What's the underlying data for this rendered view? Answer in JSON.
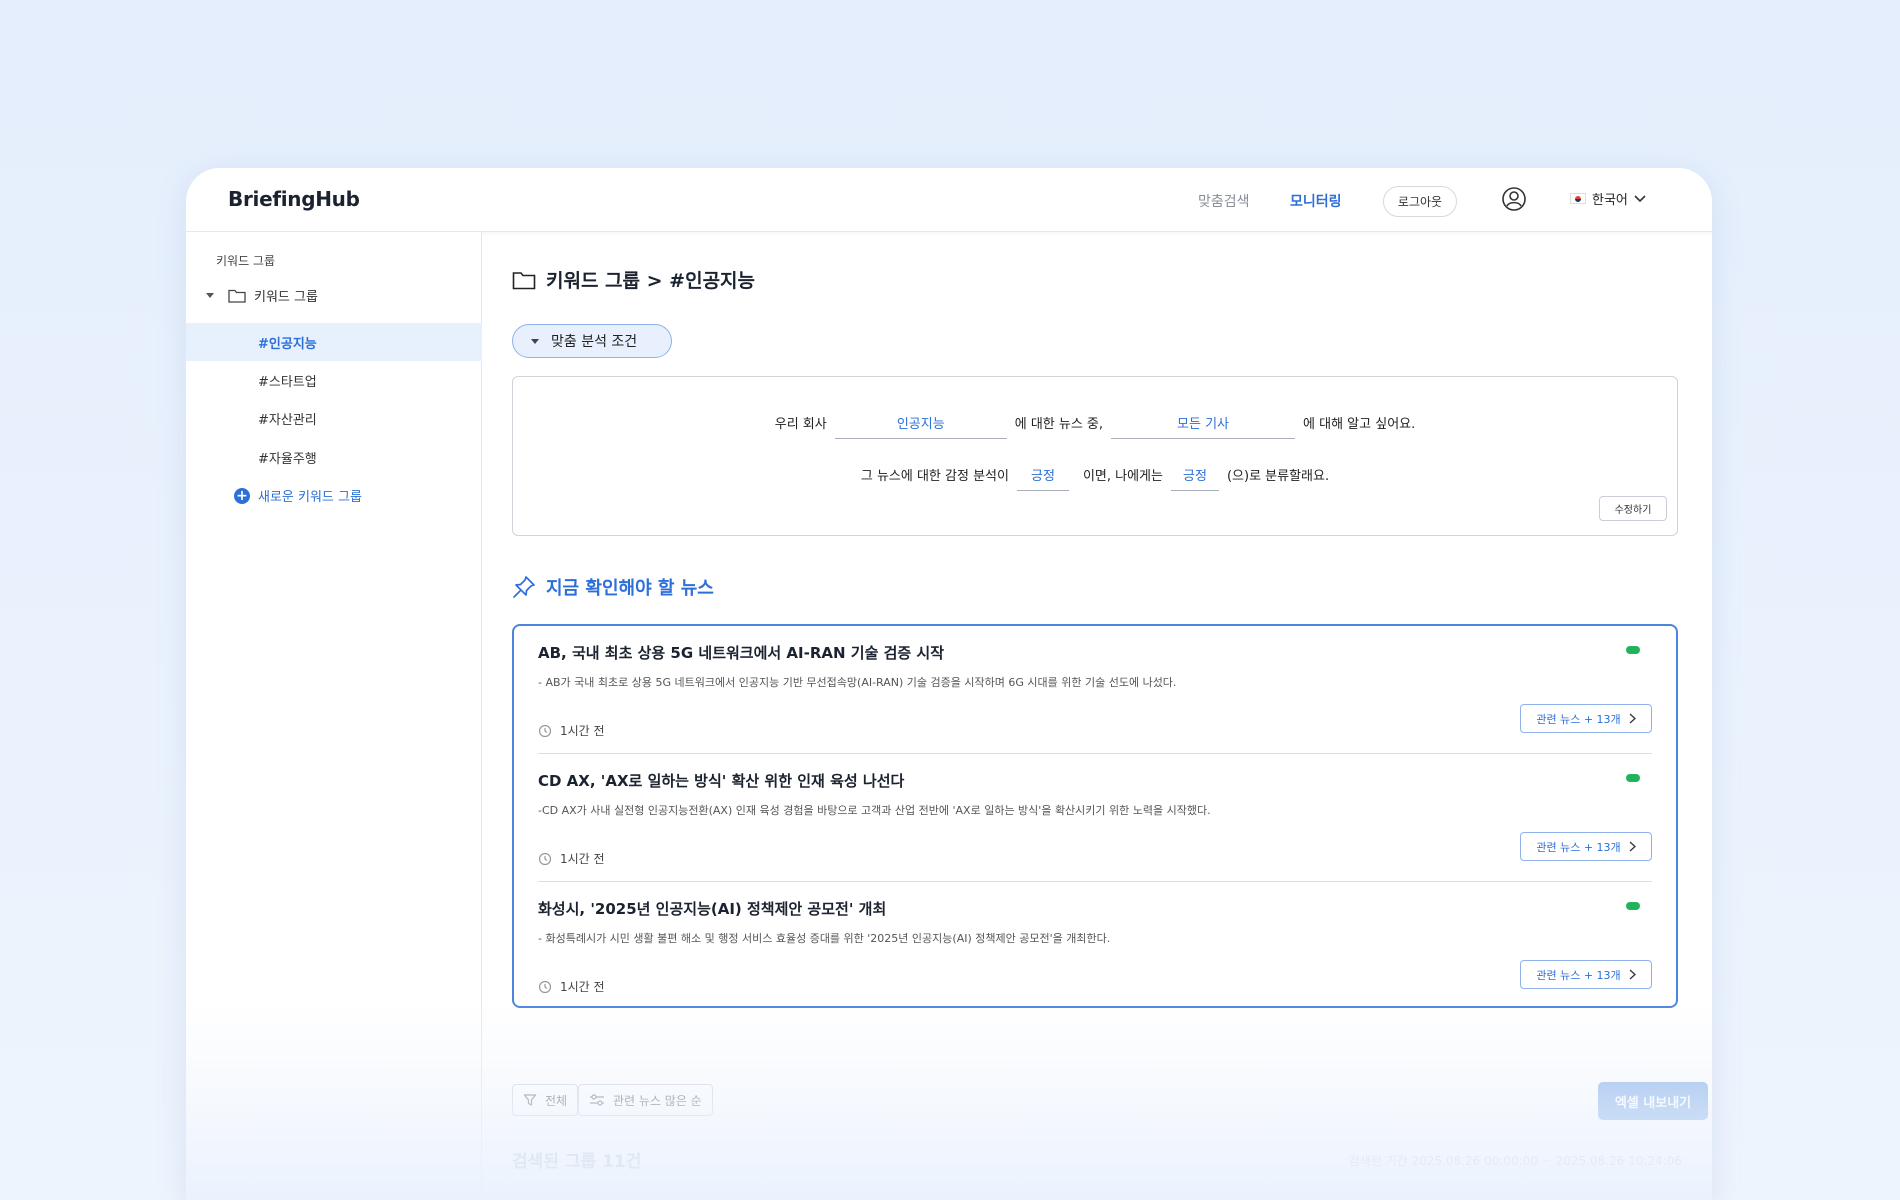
{
  "header": {
    "logo": "BriefingHub",
    "nav": [
      "맞춤검색",
      "모니터링"
    ],
    "active_nav": "모니터링",
    "logout_label": "로그아웃",
    "language": "한국어"
  },
  "sidebar": {
    "heading": "키워드 그룹",
    "root_label": "키워드 그룹",
    "items": [
      {
        "label": "#인공지능",
        "active": true
      },
      {
        "label": "#스타트업",
        "active": false
      },
      {
        "label": "#자산관리",
        "active": false
      },
      {
        "label": "#자율주행",
        "active": false
      }
    ],
    "new_group_label": "새로운 키워드 그룹"
  },
  "main": {
    "page_title": "키워드 그룹 > #인공지능",
    "condition_toggle_label": "맞춤 분석 조건",
    "condition": {
      "line1": {
        "prefix": "우리 회사",
        "keyword": "인공지능",
        "mid": "에 대한 뉴스 중,",
        "scope": "모든 기사",
        "suffix": "에 대해 알고 싶어요."
      },
      "line2": {
        "prefix": "그 뉴스에 대한 감정 분석이",
        "sentiment": "긍정",
        "mid": "이면, 나에게는",
        "classification": "긍정",
        "suffix": "(으)로 분류할래요."
      },
      "edit_label": "수정하기"
    },
    "news_heading": "지금 확인해야 할 뉴스",
    "news": [
      {
        "title": "AB, 국내 최초 상용 5G 네트워크에서 AI-RAN 기술 검증 시작",
        "summary": "- AB가 국내 최초로 상용 5G 네트워크에서 인공지능 기반 무선접속망(AI-RAN) 기술 검증을 시작하며 6G 시대를 위한 기술 선도에 나섰다.",
        "time": "1시간 전",
        "related_label": "관련 뉴스 + 13개"
      },
      {
        "title": "CD AX, 'AX로 일하는 방식' 확산 위한 인재 육성 나선다",
        "summary": "-CD AX가 사내 실전형 인공지능전환(AX) 인재 육성 경험을 바탕으로 고객과 산업 전반에 'AX로 일하는 방식'을 확산시키기 위한 노력을 시작했다.",
        "time": "1시간 전",
        "related_label": "관련 뉴스 + 13개"
      },
      {
        "title": "화성시, '2025년 인공지능(AI) 정책제안 공모전' 개최",
        "summary": "- 화성특례시가 시민 생활 불편 해소 및 행정 서비스 효율성 증대를 위한 '2025년 인공지능(AI) 정책제안 공모전'을 개최한다.",
        "time": "1시간 전",
        "related_label": "관련 뉴스 + 13개"
      }
    ],
    "filter_all_label": "전체",
    "sort_label": "관련 뉴스 많은 순",
    "export_label": "엑셀 내보내기",
    "result_count": "검색된 그룹 11건",
    "search_period": "검색된 기간 2025.08.26 00:00:00 ~ 2025.08.26 10:24:06"
  },
  "colors": {
    "accent": "#2d6fd8",
    "status_positive": "#22b35a"
  }
}
